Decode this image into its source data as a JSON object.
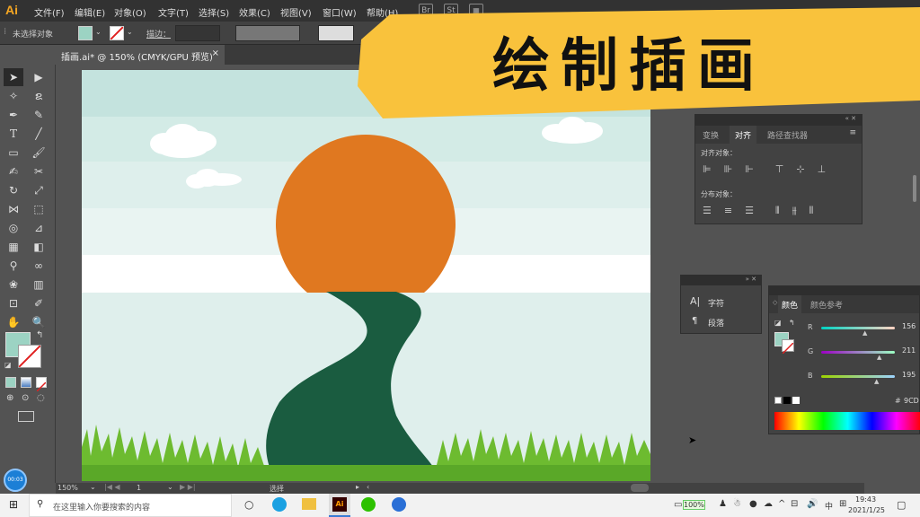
{
  "app": {
    "logo": "Ai",
    "menus": [
      "文件(F)",
      "编辑(E)",
      "对象(O)",
      "文字(T)",
      "选择(S)",
      "效果(C)",
      "视图(V)",
      "窗口(W)",
      "帮助(H)"
    ],
    "bridge": "Br",
    "stock": "St"
  },
  "control": {
    "selection": "未选择对象",
    "stroke_label": "描边："
  },
  "doc": {
    "tab_title": "插画.ai* @ 150% (CMYK/GPU 预览)",
    "close": "×"
  },
  "banner": {
    "title": "绘制插画"
  },
  "align_panel": {
    "tabs": [
      "变换",
      "对齐",
      "路径查找器"
    ],
    "align_objects": "对齐对象：",
    "distribute_objects": "分布对象："
  },
  "char_panel": {
    "character": "字符",
    "paragraph": "段落"
  },
  "color_panel": {
    "tabs": [
      "颜色",
      "颜色参考"
    ],
    "r_label": "R",
    "g_label": "G",
    "b_label": "B",
    "r": "156",
    "g": "211",
    "b": "195",
    "hash": "#",
    "hex": "9CD"
  },
  "status": {
    "zoom": "150%",
    "page": "1",
    "tool": "选择"
  },
  "taskbar": {
    "search_placeholder": "在这里输入你要搜索的内容",
    "battery": "100%",
    "ime": "中",
    "time": "19:43",
    "date": "2021/1/25"
  },
  "colors": {
    "sky_top": "#c4e3de",
    "sky_light": "#e8f3f1",
    "sun": "#e07820",
    "path": "#1a5c40",
    "grass": "#6dbb30",
    "banner": "#f9c23c",
    "fill_swatch": "#9cd3c3"
  }
}
